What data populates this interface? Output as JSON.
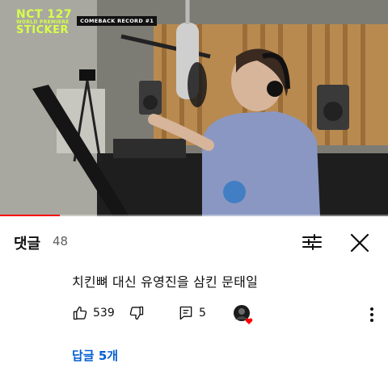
{
  "video": {
    "show_title_line1": "NCT 127",
    "show_title_line2": "WORLD PREMIERE",
    "show_title_line3": "STICKER",
    "episode_tag": "COMEBACK RECORD #1",
    "progress_fraction": 0.155,
    "buffer_fraction": 0.0
  },
  "comments": {
    "title": "댓글",
    "count": "48",
    "icons": {
      "filter": "sort-filter-icon",
      "close": "close-icon"
    }
  },
  "comment": {
    "text": "치킨뼈 대신 유영진을 삼킨 문태일",
    "likes": "539",
    "replies_count": "5",
    "replies_link": "답글 5개",
    "icons": {
      "like": "thumbs-up-icon",
      "dislike": "thumbs-down-icon",
      "reply": "reply-icon",
      "creator_heart": "creator-heart-avatar",
      "more": "more-vertical-icon"
    }
  },
  "colors": {
    "accent_red": "#ff0000",
    "link_blue": "#065fd4",
    "title_green": "#d7ff4a"
  }
}
